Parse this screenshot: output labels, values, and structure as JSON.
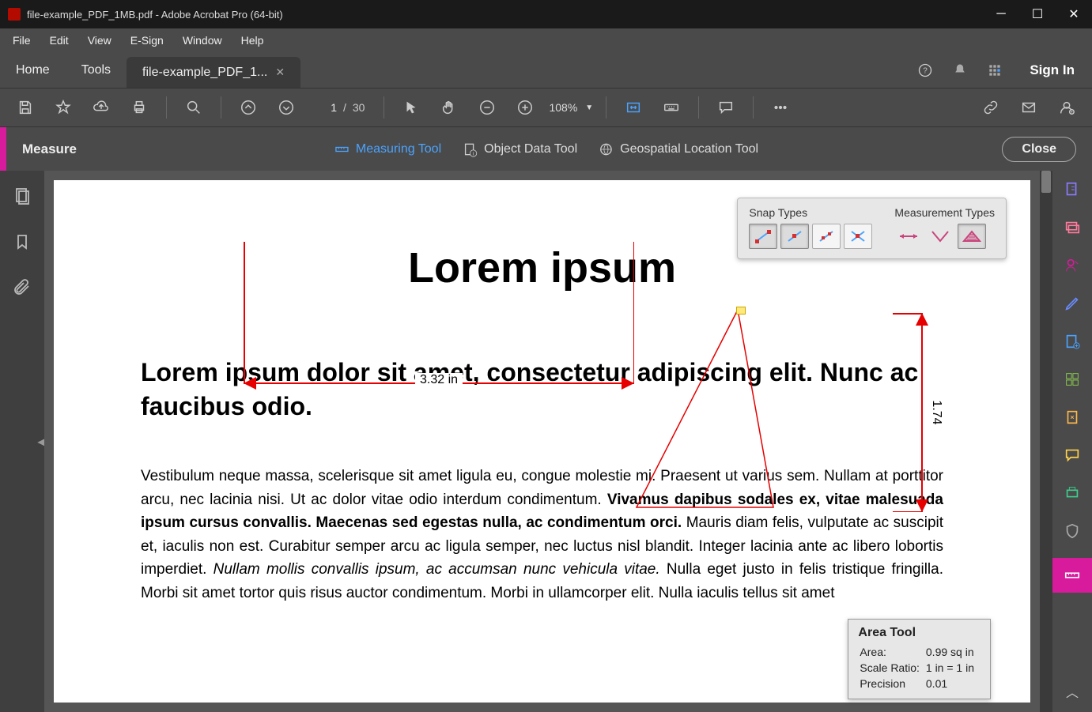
{
  "window": {
    "title": "file-example_PDF_1MB.pdf - Adobe Acrobat Pro (64-bit)"
  },
  "menu": [
    "File",
    "Edit",
    "View",
    "E-Sign",
    "Window",
    "Help"
  ],
  "tabs": {
    "home": "Home",
    "tools": "Tools",
    "doc": "file-example_PDF_1..."
  },
  "topright": {
    "signin": "Sign In"
  },
  "toolbar": {
    "page_current": "1",
    "page_sep": "/",
    "page_total": "30",
    "zoom": "108%"
  },
  "measure_bar": {
    "label": "Measure",
    "measuring": "Measuring Tool",
    "object": "Object Data Tool",
    "geo": "Geospatial Location Tool",
    "close": "Close"
  },
  "snap_panel": {
    "snap_label": "Snap Types",
    "measure_label": "Measurement Types"
  },
  "doc": {
    "title": "Lorem ipsum",
    "subtitle": "Lorem ipsum dolor sit amet, consectetur adipiscing elit. Nunc ac faucibus odio.",
    "body_plain1": "Vestibulum neque massa, scelerisque sit amet ligula eu, congue molestie mi. Praesent ut varius sem. Nullam at porttitor arcu, nec lacinia nisi. Ut ac dolor vitae odio interdum condimentum. ",
    "body_bold": "Vivamus dapibus sodales ex, vitae malesuada ipsum cursus convallis. Maecenas sed egestas nulla, ac condimentum orci.",
    "body_plain2": " Mauris diam felis, vulputate ac suscipit et, iaculis non est. Curabitur semper arcu ac ligula semper, nec luctus nisl blandit. Integer lacinia ante ac libero lobortis imperdiet. ",
    "body_italic": "Nullam mollis convallis ipsum, ac accumsan nunc vehicula vitae.",
    "body_plain3": " Nulla eget justo in felis tristique fringilla. Morbi sit amet tortor quis risus auctor condimentum. Morbi in ullamcorper elit. Nulla iaculis tellus sit amet"
  },
  "dims": {
    "horizontal": "3.32 in",
    "vertical": "1.74"
  },
  "area_tool": {
    "title": "Area Tool",
    "area_label": "Area:",
    "area_val": "0.99 sq in",
    "scale_label": "Scale Ratio:",
    "scale_val": "1 in = 1 in",
    "precision_label": "Precision",
    "precision_val": "0.01"
  }
}
